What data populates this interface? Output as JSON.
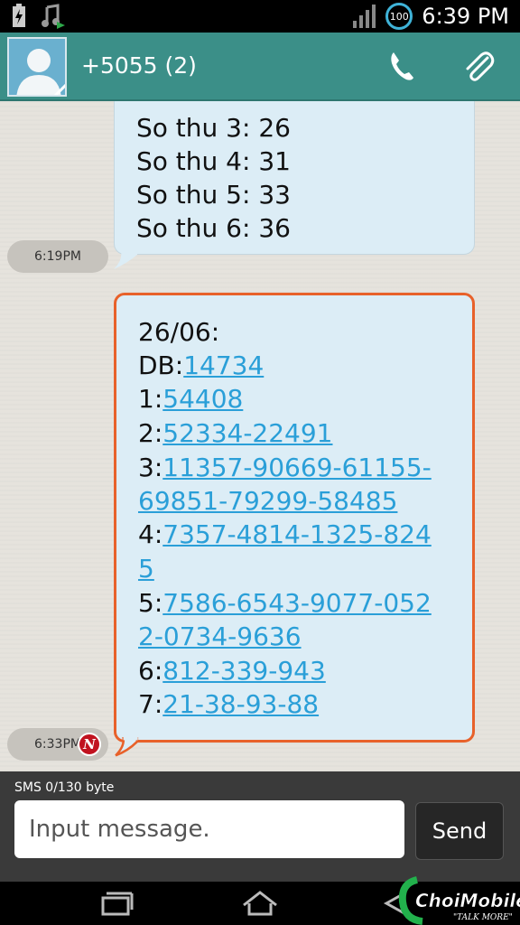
{
  "status_bar": {
    "time": "6:39 PM",
    "battery": "100"
  },
  "header": {
    "contact": "+5055 (2)"
  },
  "messages": [
    {
      "time": "6:19PM",
      "lines": [
        {
          "prefix": "So thu 3: 26",
          "link": ""
        },
        {
          "prefix": "So thu 4: 31",
          "link": ""
        },
        {
          "prefix": "So thu 5: 33",
          "link": ""
        },
        {
          "prefix": "So thu 6: 36",
          "link": ""
        }
      ]
    },
    {
      "time": "6:33PM",
      "badge": "N",
      "lines": [
        {
          "prefix": "26/06:",
          "link": ""
        },
        {
          "prefix": "DB:",
          "link": "14734"
        },
        {
          "prefix": "1:",
          "link": "54408"
        },
        {
          "prefix": "2:",
          "link": "52334-22491"
        },
        {
          "prefix": "3:",
          "link": "11357-90669-61155-"
        },
        {
          "prefix": "",
          "link": "69851-79299-58485"
        },
        {
          "prefix": "4:",
          "link": "7357-4814-1325-824"
        },
        {
          "prefix": "",
          "link": "5"
        },
        {
          "prefix": "5:",
          "link": "7586-6543-9077-052"
        },
        {
          "prefix": "",
          "link": "2-0734-9636"
        },
        {
          "prefix": "6:",
          "link": "812-339-943"
        },
        {
          "prefix": "7:",
          "link": "21-38-93-88"
        }
      ]
    }
  ],
  "composer": {
    "info": "SMS  0/130 byte",
    "placeholder": "Input message.",
    "send_label": "Send"
  },
  "watermark": {
    "brand": "ChoiMobile",
    "tagline": "\"TALK MORE\""
  }
}
